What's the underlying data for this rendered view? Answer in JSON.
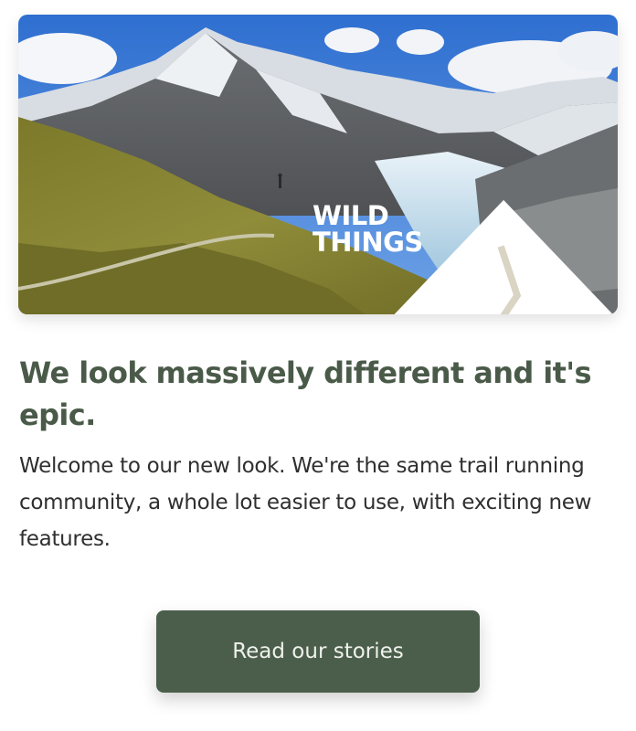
{
  "hero": {
    "brand_line1": "WILD",
    "brand_line2": "THINGS",
    "icon": "wild-things-logo-icon"
  },
  "content": {
    "headline": "We look massively different and it's epic.",
    "body": "Welcome to our new look. We're the same trail running community, a whole lot easier to use, with exciting new features."
  },
  "cta": {
    "label": "Read our stories"
  },
  "colors": {
    "headline": "#4a5a49",
    "button_bg": "#4b5e4b",
    "button_text": "#eef1ec"
  }
}
